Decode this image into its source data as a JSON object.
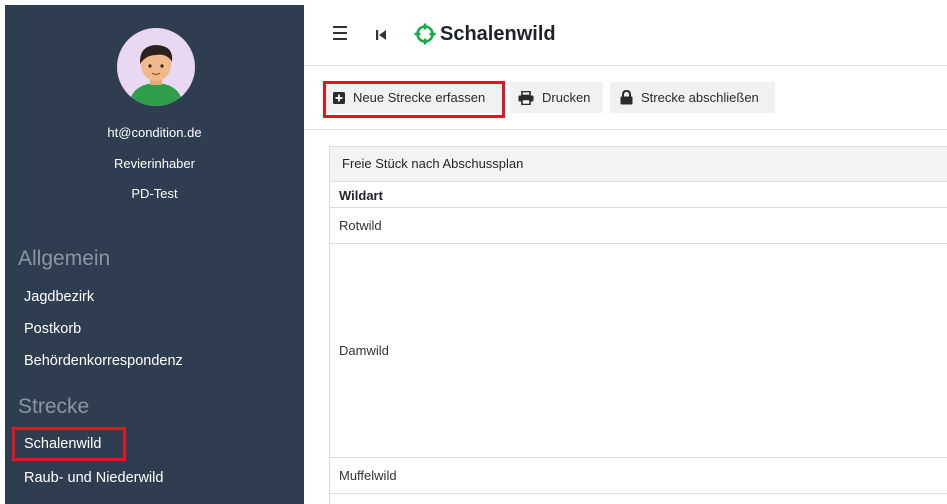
{
  "sidebar": {
    "user": {
      "email": "ht@condition.de",
      "role": "Revierinhaber",
      "org": "PD-Test"
    },
    "sections": [
      {
        "title": "Allgemein",
        "items": [
          "Jagdbezirk",
          "Postkorb",
          "Behördenkorrespondenz"
        ]
      },
      {
        "title": "Strecke",
        "items": [
          "Schalenwild",
          "Raub- und Niederwild"
        ]
      }
    ],
    "active_item": "Schalenwild"
  },
  "header": {
    "title": "Schalenwild",
    "title_icon": "crosshair-icon"
  },
  "toolbar": {
    "new_label": "Neue Strecke erfassen",
    "print_label": "Drucken",
    "close_label": "Strecke abschließen"
  },
  "panel": {
    "title": "Freie Stück nach Abschussplan",
    "column_header": "Wildart",
    "rows": [
      "Rotwild",
      "Damwild",
      "Muffelwild"
    ]
  },
  "colors": {
    "sidebar_bg": "#2e3d50",
    "accent": "#1fa84a",
    "highlight": "#e3141d"
  }
}
